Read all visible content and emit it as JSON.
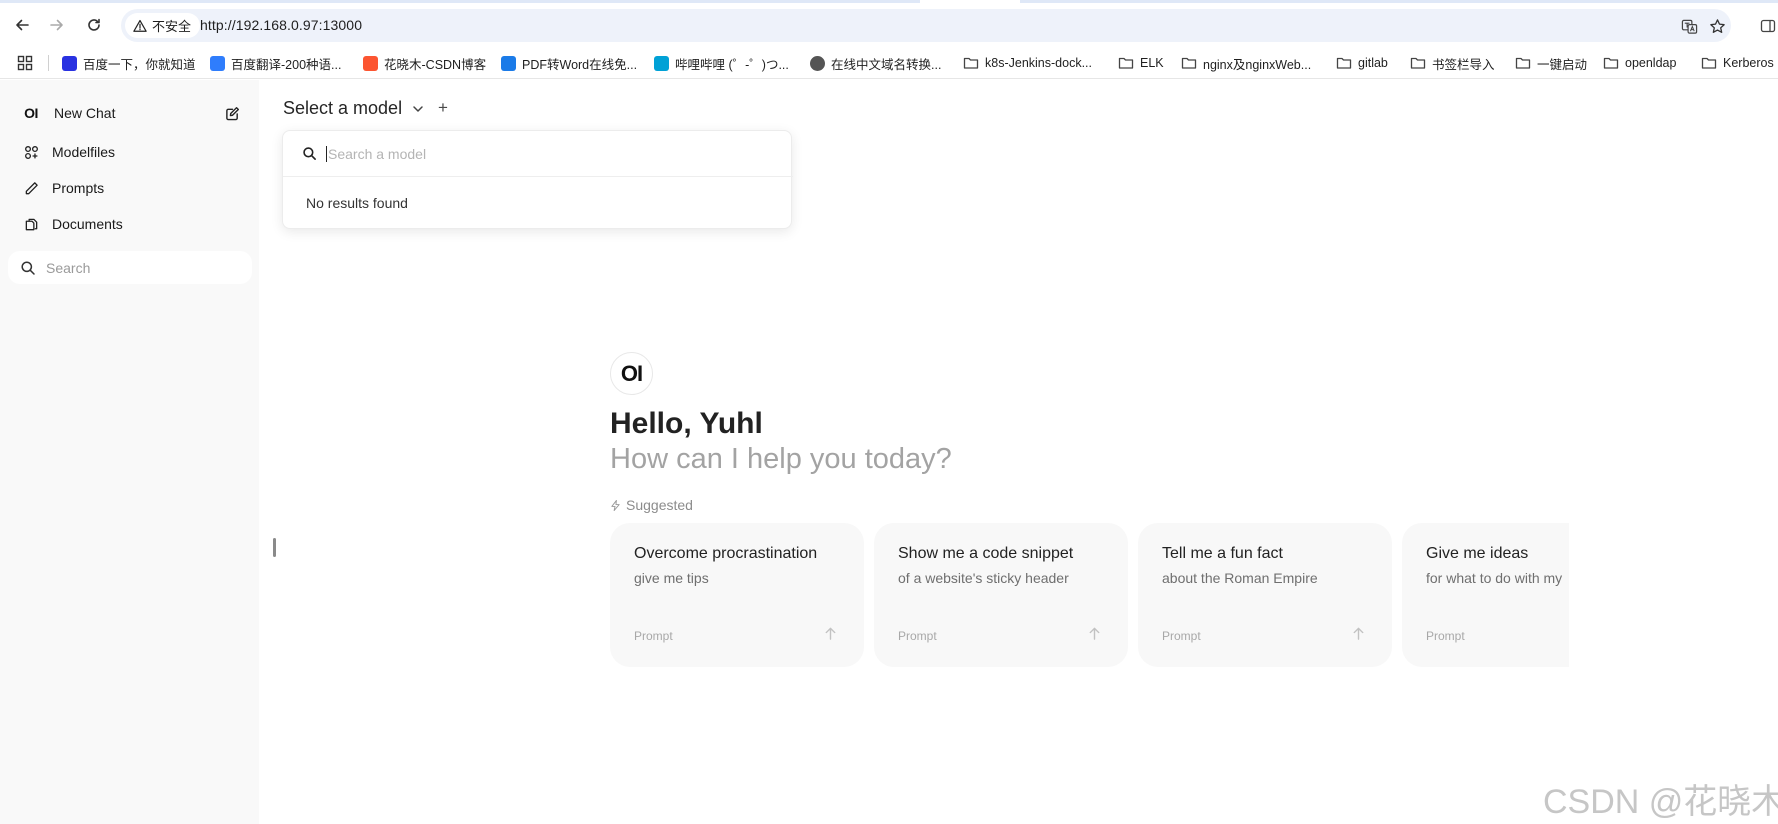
{
  "browser": {
    "security_label": "不安全",
    "url": "http://192.168.0.97:13000",
    "bookmarks": [
      {
        "label": "百度一下，你就知道",
        "icon": "baidu-paw-icon",
        "color": "#2932e1"
      },
      {
        "label": "百度翻译-200种语...",
        "icon": "translate-icon",
        "color": "#2f7dfc"
      },
      {
        "label": "花晓木-CSDN博客",
        "icon": "csdn-icon",
        "color": "#fc5531"
      },
      {
        "label": "PDF转Word在线免...",
        "icon": "pdf-icon",
        "color": "#1b7be8"
      },
      {
        "label": "哔哩哔哩 (゜-゜)つ...",
        "icon": "bilibili-icon",
        "color": "#00a1d6"
      },
      {
        "label": "在线中文域名转换...",
        "icon": "globe-icon",
        "color": "#555555"
      },
      {
        "label": "k8s-Jenkins-dock...",
        "icon": "folder-icon"
      },
      {
        "label": "ELK",
        "icon": "folder-icon"
      },
      {
        "label": "nginx及nginxWeb...",
        "icon": "folder-icon"
      },
      {
        "label": "gitlab",
        "icon": "folder-icon"
      },
      {
        "label": "书签栏导入",
        "icon": "folder-icon"
      },
      {
        "label": "一键启动",
        "icon": "folder-icon"
      },
      {
        "label": "openldap",
        "icon": "folder-icon"
      },
      {
        "label": "Kerberos",
        "icon": "folder-icon"
      }
    ]
  },
  "sidebar": {
    "logo": "OI",
    "new_chat": "New Chat",
    "items": [
      {
        "label": "Modelfiles",
        "icon": "modelfiles-icon"
      },
      {
        "label": "Prompts",
        "icon": "pencil-icon"
      },
      {
        "label": "Documents",
        "icon": "documents-icon"
      }
    ],
    "search_placeholder": "Search"
  },
  "model_selector": {
    "title": "Select a model",
    "add": "+",
    "search_placeholder": "Search a model",
    "empty_text": "No results found"
  },
  "hero": {
    "logo": "OI",
    "greeting": "Hello, Yuhl",
    "subtitle": "How can I help you today?",
    "suggested_label": "Suggested"
  },
  "suggestions": [
    {
      "title": "Overcome procrastination",
      "subtitle": "give me tips",
      "tag": "Prompt"
    },
    {
      "title": "Show me a code snippet",
      "subtitle": "of a website's sticky header",
      "tag": "Prompt"
    },
    {
      "title": "Tell me a fun fact",
      "subtitle": "about the Roman Empire",
      "tag": "Prompt"
    },
    {
      "title": "Give me ideas",
      "subtitle": "for what to do with my",
      "tag": "Prompt"
    }
  ],
  "watermark": "CSDN @花晓木"
}
